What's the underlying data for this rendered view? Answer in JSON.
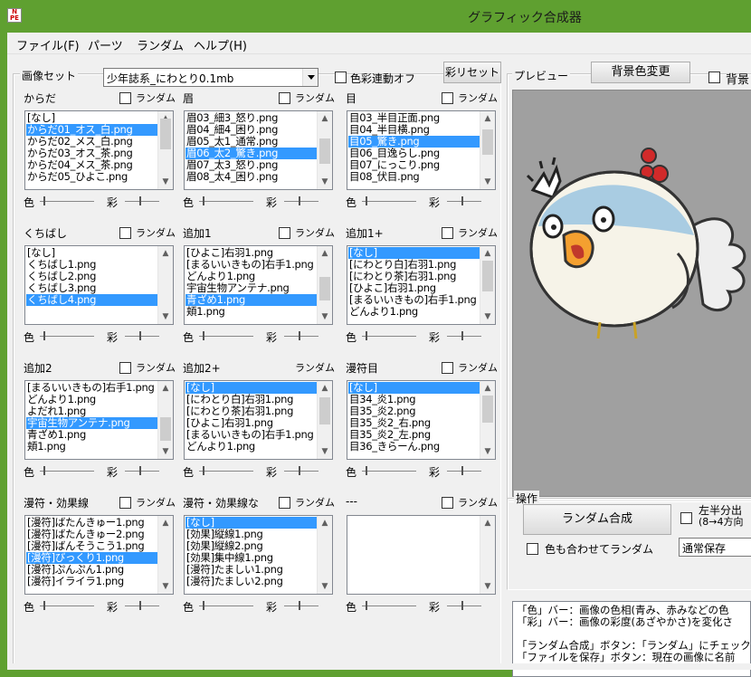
{
  "window": {
    "title": "グラフィック合成器",
    "icon": "app-logo-icon"
  },
  "menu": [
    {
      "label": "ファイル(F)"
    },
    {
      "label": "パーツ"
    },
    {
      "label": "ランダム"
    },
    {
      "label": "ヘルプ(H)"
    }
  ],
  "imageset": {
    "group_label": "画像セット",
    "selected": "少年誌系_にわとり0.1mb",
    "color_link_label": "色彩連動オフ",
    "saturation_reset": "彩リセット"
  },
  "preview": {
    "group_label": "プレビュー",
    "bg_button": "背景色変更",
    "bg_check_label": "背景"
  },
  "labels": {
    "random": "ランダム",
    "color": "色",
    "saturation": "彩"
  },
  "panels": [
    {
      "title": "からだ",
      "has_check": true,
      "items": [
        "[なし]",
        "からだ01_オス_白.png",
        "からだ02_メス_白.png",
        "からだ03_オス_茶.png",
        "からだ04_メス_茶.png",
        "からだ05_ひよこ.png"
      ],
      "selected": 1,
      "thumb": [
        8,
        34
      ]
    },
    {
      "title": "眉",
      "has_check": true,
      "items": [
        "眉03_細3_怒り.png",
        "眉04_細4_困り.png",
        "眉05_太1_通常.png",
        "眉06_太2_驚き.png",
        "眉07_太3_怒り.png",
        "眉08_太4_困り.png"
      ],
      "selected": 3,
      "thumb": [
        30,
        28
      ]
    },
    {
      "title": "目",
      "has_check": true,
      "items": [
        "目03_半目正面.png",
        "目04_半目横.png",
        "目05_驚き.png",
        "目06_目逸らし.png",
        "目07_にっこり.png",
        "目08_伏目.png"
      ],
      "selected": 2,
      "thumb": [
        20,
        28
      ]
    },
    {
      "title": "くちばし",
      "has_check": true,
      "items": [
        "[なし]",
        "くちばし1.png",
        "くちばし2.png",
        "くちばし3.png",
        "くちばし4.png"
      ],
      "selected": 4,
      "thumb": null
    },
    {
      "title": "追加1",
      "has_check": true,
      "items": [
        "[ひよこ]右羽1.png",
        "[まるいいきもの]右手1.png",
        "どんより1.png",
        "宇宙生物アンテナ.png",
        "青ざめ1.png",
        "頬1.png"
      ],
      "selected": 4,
      "thumb": [
        34,
        26
      ]
    },
    {
      "title": "追加1+",
      "has_check": true,
      "items": [
        "[なし]",
        "[にわとり白]右羽1.png",
        "[にわとり茶]右羽1.png",
        "[ひよこ]右羽1.png",
        "[まるいいきもの]右手1.png",
        "どんより1.png"
      ],
      "selected": 0,
      "thumb": [
        16,
        34
      ]
    },
    {
      "title": "追加2",
      "has_check": true,
      "items": [
        "[まるいいきもの]右手1.png",
        "どんより1.png",
        "よだれ1.png",
        "宇宙生物アンテナ.png",
        "青ざめ1.png",
        "頬1.png"
      ],
      "selected": 3,
      "thumb": [
        40,
        26
      ]
    },
    {
      "title": "追加2+",
      "has_check": false,
      "items": [
        "[なし]",
        "[にわとり白]右羽1.png",
        "[にわとり茶]右羽1.png",
        "[ひよこ]右羽1.png",
        "[まるいいきもの]右手1.png",
        "どんより1.png"
      ],
      "selected": 0,
      "thumb": [
        18,
        30
      ]
    },
    {
      "title": "漫符目",
      "has_check": true,
      "items": [
        "[なし]",
        "目34_炎1.png",
        "目35_炎2.png",
        "目35_炎2_右.png",
        "目35_炎2_左.png",
        "目36_きらーん.png"
      ],
      "selected": 0,
      "thumb": [
        16,
        30
      ]
    },
    {
      "title": "漫符・効果線",
      "has_check": true,
      "items": [
        "[漫符]ばたんきゅー1.png",
        "[漫符]ばたんきゅー2.png",
        "[漫符]ばんそうこう1.png",
        "[漫符]びっくり1.png",
        "[漫符]ぷんぷん1.png",
        "[漫符]イライラ1.png"
      ],
      "selected": 3,
      "thumb": null
    },
    {
      "title": "漫符・効果線な",
      "has_check": true,
      "items": [
        "[なし]",
        "[効果]縦線1.png",
        "[効果]縦線2.png",
        "[効果]集中線1.png",
        "[漫符]たましい1.png",
        "[漫符]たましい2.png"
      ],
      "selected": 0,
      "thumb": null
    },
    {
      "title": "---",
      "has_check": true,
      "items": [],
      "selected": -1,
      "thumb": null
    }
  ],
  "operation": {
    "group_label": "操作",
    "random_compose": "ランダム合成",
    "color_random_label": "色も合わせてランダム",
    "split_label_1": "左半分出",
    "split_label_2": "(8→4方向",
    "save_mode": "通常保存"
  },
  "help_text": [
    "「色」バー：画像の色相(青み、赤みなどの色",
    "「彩」バー：画像の彩度(あざやかさ)を変化さ",
    "",
    "「ランダム合成」ボタン：「ランダム」にチェックが",
    "「ファイルを保存」ボタン：現在の画像に名前"
  ],
  "colors": {
    "selection": "#3399ff",
    "titlebar": "#5fa030",
    "preview_bg": "#a0a0a0"
  }
}
